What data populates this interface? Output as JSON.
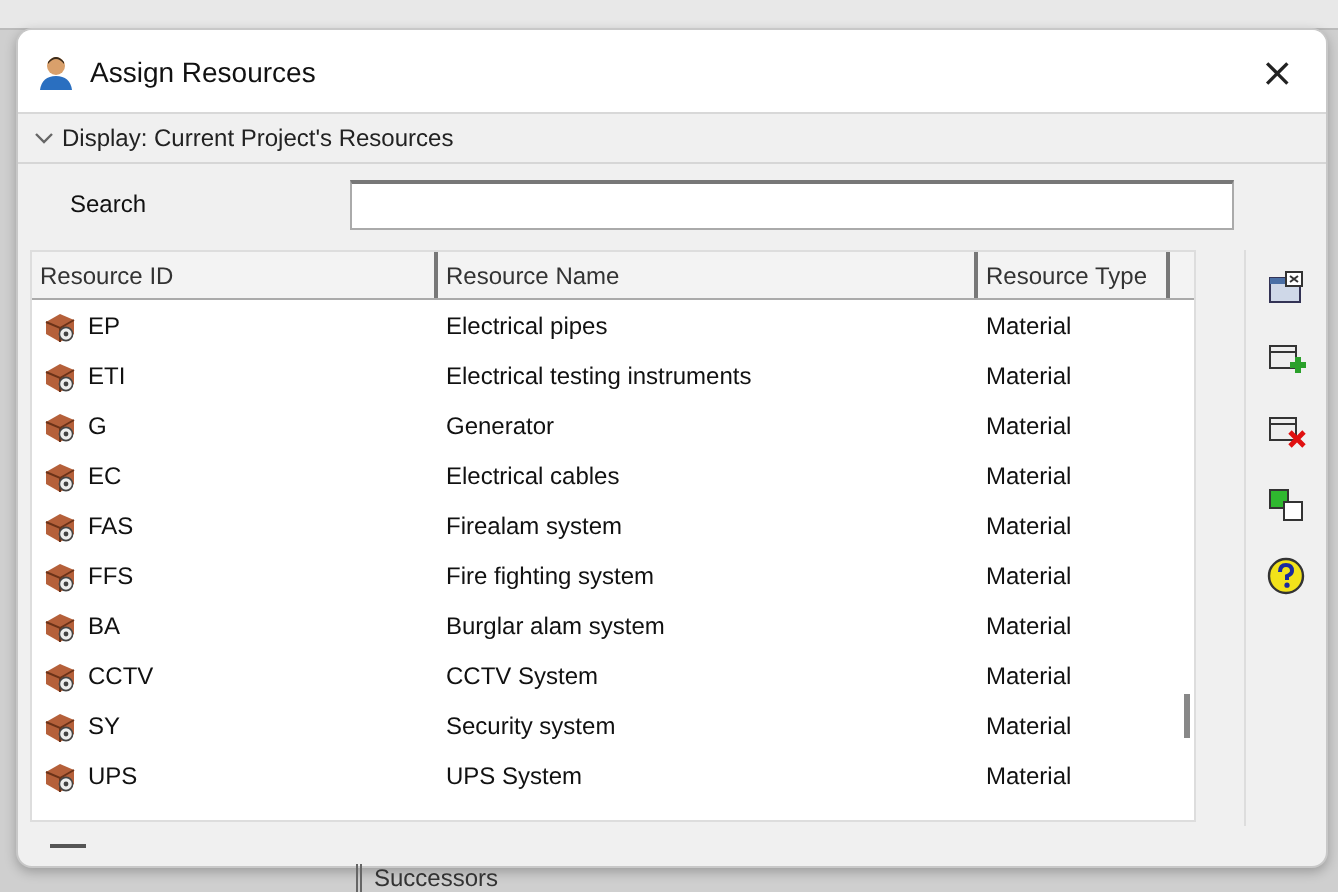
{
  "window": {
    "title": "Assign Resources",
    "close": "×"
  },
  "display_filter": {
    "label": "Display: Current Project's Resources",
    "expanded": true
  },
  "search": {
    "label": "Search"
  },
  "table": {
    "columns": [
      "Resource ID",
      "Resource Name",
      "Resource Type"
    ],
    "rows": [
      {
        "id": "EP",
        "name": "Electrical pipes",
        "type": "Material"
      },
      {
        "id": "ETI",
        "name": "Electrical testing instruments",
        "type": "Material"
      },
      {
        "id": "G",
        "name": "Generator",
        "type": "Material"
      },
      {
        "id": "EC",
        "name": "Electrical cables",
        "type": "Material"
      },
      {
        "id": "FAS",
        "name": "Firealam system",
        "type": "Material"
      },
      {
        "id": "FFS",
        "name": "Fire fighting system",
        "type": "Material"
      },
      {
        "id": "BA",
        "name": "Burglar alam system",
        "type": "Material"
      },
      {
        "id": "CCTV",
        "name": "CCTV System",
        "type": "Material"
      },
      {
        "id": "SY",
        "name": "Security system",
        "type": "Material"
      },
      {
        "id": "UPS",
        "name": "UPS System",
        "type": "Material"
      }
    ]
  },
  "toolbar": [
    {
      "kind": "close-pane"
    },
    {
      "kind": "add"
    },
    {
      "kind": "remove"
    },
    {
      "kind": "replace"
    },
    {
      "kind": "help"
    }
  ],
  "background": {
    "tab_label": "Successors"
  }
}
